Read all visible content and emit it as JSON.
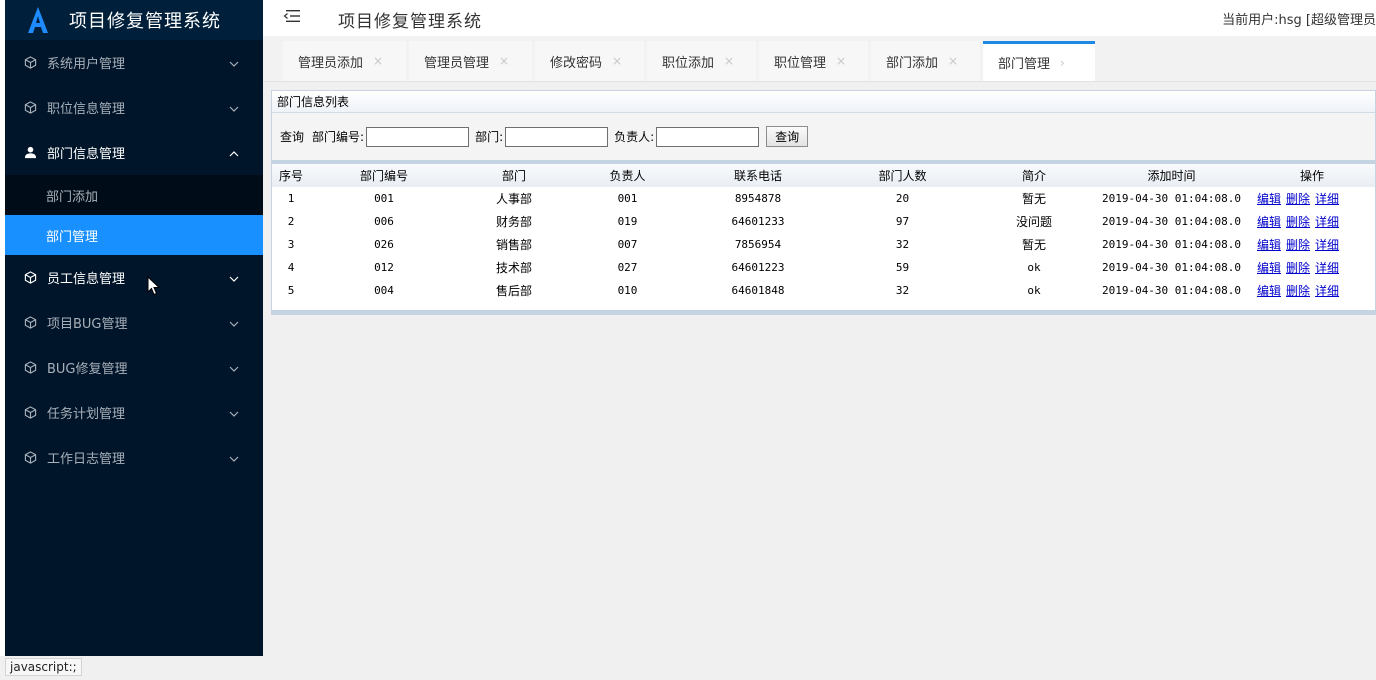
{
  "app": {
    "logo_text": "项目修复管理系统",
    "header_title": "项目修复管理系统",
    "current_user": "当前用户:hsg [超级管理员"
  },
  "sidebar": {
    "items": [
      {
        "label": "系统用户管理",
        "icon": "cube-icon",
        "open": false
      },
      {
        "label": "职位信息管理",
        "icon": "cube-icon",
        "open": false
      },
      {
        "label": "部门信息管理",
        "icon": "user-icon",
        "open": true
      },
      {
        "label": "员工信息管理",
        "icon": "cube-icon",
        "open": false
      },
      {
        "label": "项目BUG管理",
        "icon": "cube-icon",
        "open": false
      },
      {
        "label": "BUG修复管理",
        "icon": "cube-icon",
        "open": false
      },
      {
        "label": "任务计划管理",
        "icon": "cube-icon",
        "open": false
      },
      {
        "label": "工作日志管理",
        "icon": "cube-icon",
        "open": false
      }
    ],
    "submenu": [
      {
        "label": "部门添加",
        "active": false
      },
      {
        "label": "部门管理",
        "active": true
      }
    ]
  },
  "tabs": [
    {
      "label": "管理员添加",
      "active": false
    },
    {
      "label": "管理员管理",
      "active": false
    },
    {
      "label": "修改密码",
      "active": false
    },
    {
      "label": "职位添加",
      "active": false
    },
    {
      "label": "职位管理",
      "active": false
    },
    {
      "label": "部门添加",
      "active": false
    },
    {
      "label": "部门管理",
      "active": true
    }
  ],
  "panel": {
    "title": "部门信息列表",
    "query": {
      "prefix": "查询",
      "code_label": "部门编号:",
      "dept_label": "部门:",
      "leader_label": "负责人:",
      "button": "查询",
      "code_value": "",
      "dept_value": "",
      "leader_value": ""
    },
    "columns": [
      "序号",
      "部门编号",
      "部门",
      "负责人",
      "联系电话",
      "部门人数",
      "简介",
      "添加时间",
      "操作"
    ],
    "rows": [
      {
        "no": "1",
        "code": "001",
        "dept": "人事部",
        "leader": "001",
        "phone": "8954878",
        "count": "20",
        "intro": "暂无",
        "time": "2019-04-30 01:04:08.0"
      },
      {
        "no": "2",
        "code": "006",
        "dept": "财务部",
        "leader": "019",
        "phone": "64601233",
        "count": "97",
        "intro": "没问题",
        "time": "2019-04-30 01:04:08.0"
      },
      {
        "no": "3",
        "code": "026",
        "dept": "销售部",
        "leader": "007",
        "phone": "7856954",
        "count": "32",
        "intro": "暂无",
        "time": "2019-04-30 01:04:08.0"
      },
      {
        "no": "4",
        "code": "012",
        "dept": "技术部",
        "leader": "027",
        "phone": "64601223",
        "count": "59",
        "intro": "ok",
        "time": "2019-04-30 01:04:08.0"
      },
      {
        "no": "5",
        "code": "004",
        "dept": "售后部",
        "leader": "010",
        "phone": "64601848",
        "count": "32",
        "intro": "ok",
        "time": "2019-04-30 01:04:08.0"
      }
    ],
    "ops": {
      "edit": "编辑",
      "delete": "删除",
      "detail": "详细"
    }
  },
  "status_bar": {
    "text": "javascript:;"
  },
  "colors": {
    "sidebar_bg": "#001529",
    "active_blue": "#1890ff",
    "tab_accent": "#1e88e5",
    "link": "#0000cc"
  }
}
